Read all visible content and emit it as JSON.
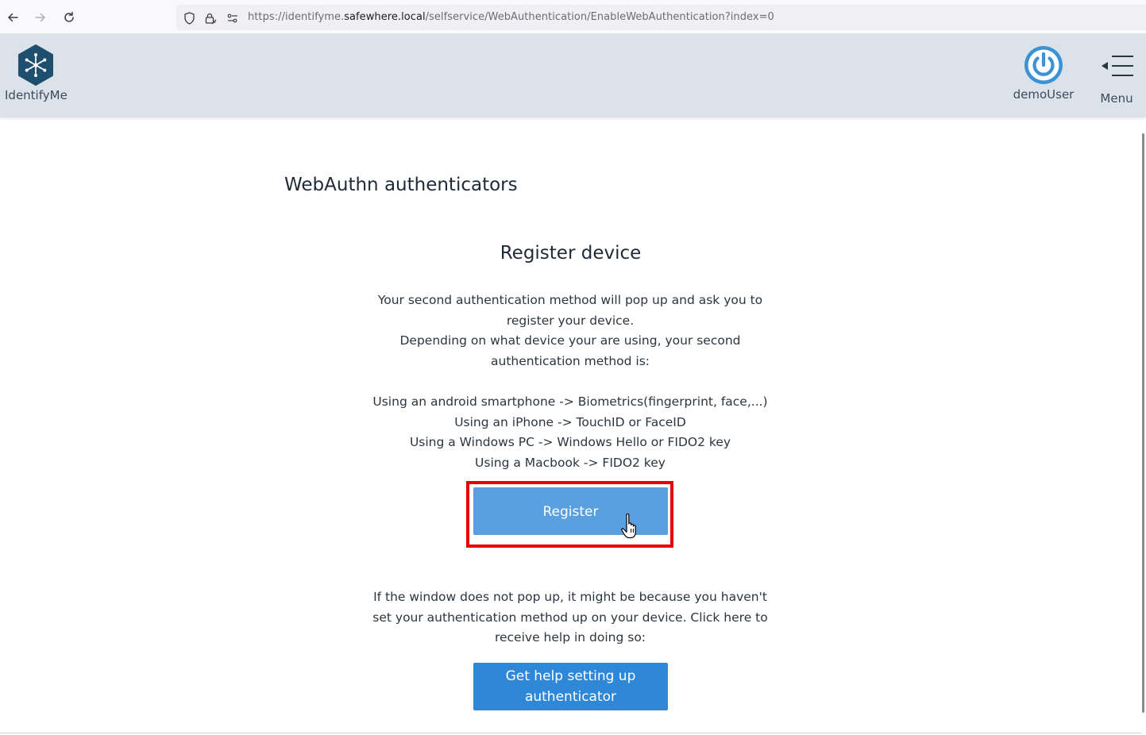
{
  "browser": {
    "url_prefix": "https://identifyme.",
    "url_host": "safewhere.local",
    "url_path": "/selfservice/WebAuthentication/EnableWebAuthentication?index=0",
    "icons": [
      "back-arrow-icon",
      "forward-arrow-icon",
      "reload-icon",
      "shield-icon",
      "lock-icon",
      "permissions-icon"
    ]
  },
  "header": {
    "brand_label": "IdentifyMe",
    "user_label": "demoUser",
    "menu_label": "Menu",
    "icons": [
      "identifyme-logo-icon",
      "power-icon",
      "menu-icon"
    ],
    "colors": {
      "header_bg": "#dbe2ea",
      "logo": "#1e4f6e",
      "power": "#3a93d6"
    }
  },
  "main": {
    "section_title": "WebAuthn authenticators",
    "card_title": "Register device",
    "description_lines": [
      "Your second authentication method will pop up and ask you to register your device.",
      "Depending on what device your are using, your second authentication method is:"
    ],
    "device_options": [
      "Using an android smartphone -> Biometrics(fingerprint, face,...)",
      "Using an iPhone -> TouchID or FaceID",
      "Using a Windows PC -> Windows Hello or FIDO2 key",
      "Using a Macbook -> FIDO2 key"
    ],
    "register_label": "Register",
    "help_text": "If the window does not pop up, it might be because you haven't set your authentication method up on your device. Click here to receive help in doing so:",
    "help_button_label": "Get help setting up authenticator",
    "colors": {
      "register_button": "#5aa0e0",
      "help_button": "#2f87d8",
      "highlight_frame": "#e60000"
    }
  }
}
